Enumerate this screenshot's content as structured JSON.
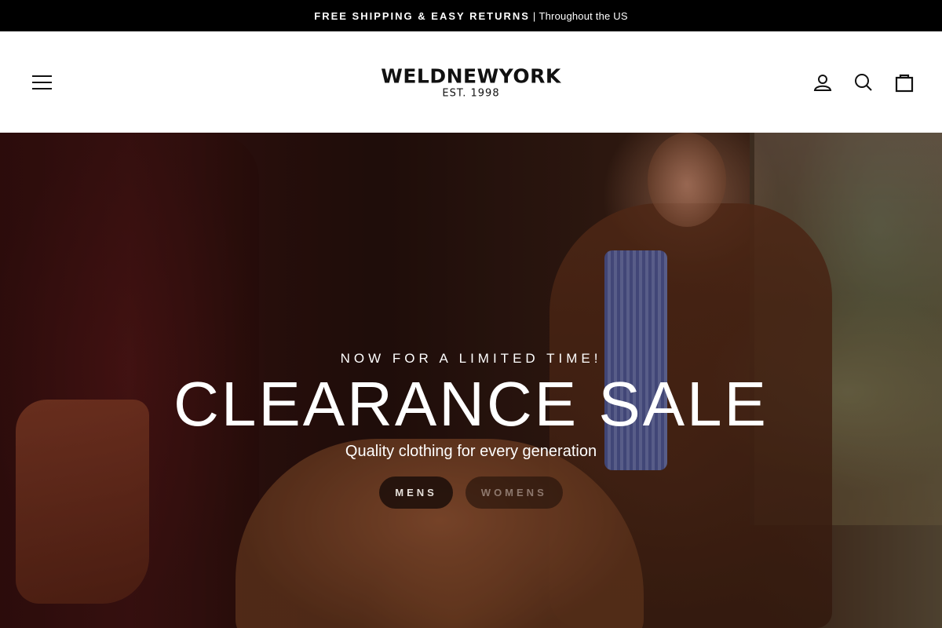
{
  "announcement": {
    "strong": "FREE SHIPPING & EASY RETURNS",
    "separator": "|",
    "rest": "Throughout the US"
  },
  "header": {
    "logo_main": "WELDNEWYORK",
    "logo_sub": "EST. 1998",
    "icons": {
      "menu": "hamburger-menu-icon",
      "account": "user-icon",
      "search": "search-icon",
      "cart": "shopping-bag-icon"
    }
  },
  "hero": {
    "kicker": "NOW FOR A LIMITED TIME!",
    "headline": "CLEARANCE SALE",
    "subline": "Quality clothing for every generation",
    "buttons": [
      {
        "label": "MENS"
      },
      {
        "label": "WOMENS"
      }
    ]
  },
  "colors": {
    "announcement_bg": "#000000",
    "header_bg": "#ffffff",
    "text_light": "#ffffff"
  }
}
